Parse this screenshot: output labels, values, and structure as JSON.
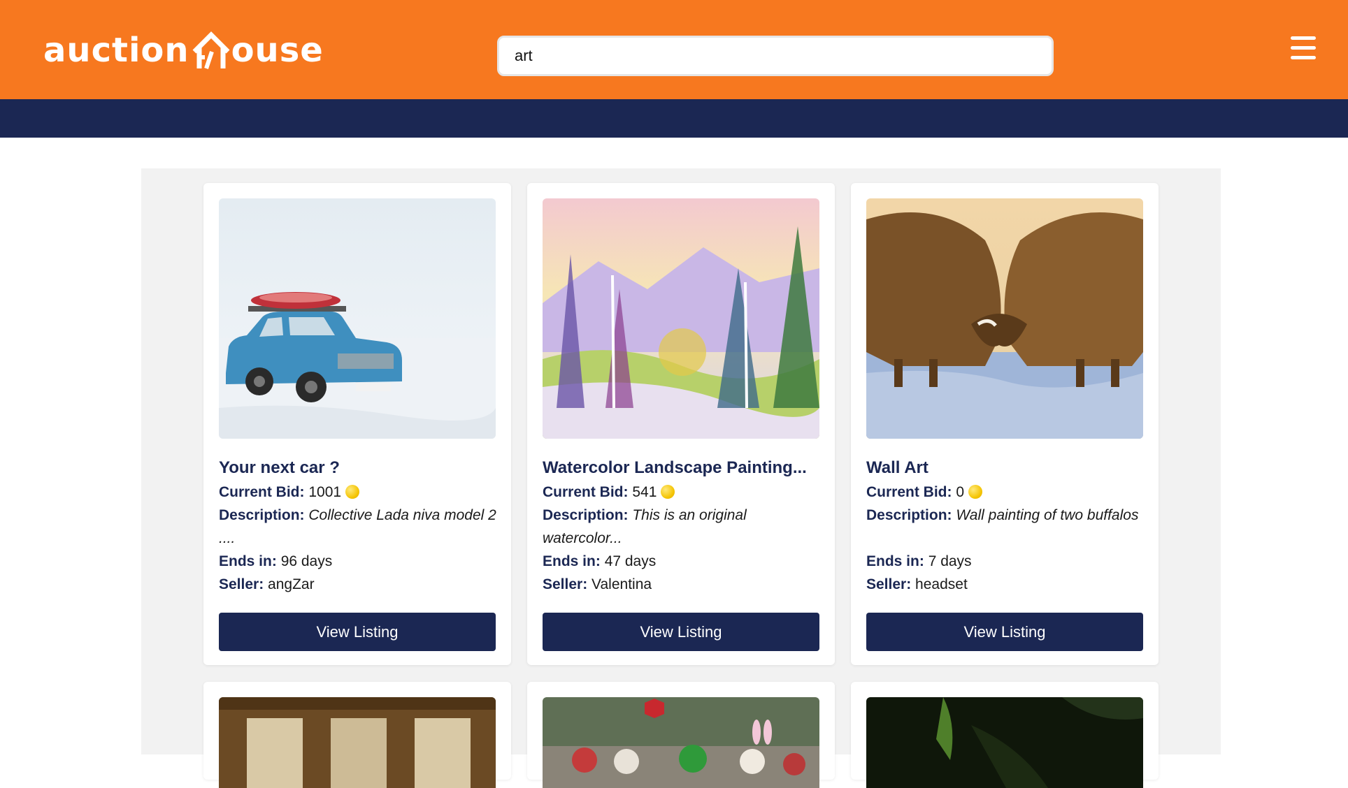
{
  "header": {
    "logo_left": "auction",
    "logo_right": "ouse",
    "search": {
      "value": "art",
      "placeholder": ""
    },
    "brand_color": "#f7781f",
    "nav_color": "#1b2753"
  },
  "listings": [
    {
      "title": "Your next car ?",
      "bid_label": "Current Bid:",
      "bid_value": "1001",
      "desc_label": "Description:",
      "desc_value": "Collective Lada niva model 2 ....",
      "ends_label": "Ends in:",
      "ends_value": "96 days",
      "seller_label": "Seller:",
      "seller_value": "angZar",
      "button_label": "View Listing",
      "image": "blue-car-in-snow"
    },
    {
      "title": "Watercolor Landscape Painting...",
      "bid_label": "Current Bid:",
      "bid_value": "541",
      "desc_label": "Description:",
      "desc_value": "This is an original watercolor...",
      "ends_label": "Ends in:",
      "ends_value": "47 days",
      "seller_label": "Seller:",
      "seller_value": "Valentina",
      "button_label": "View Listing",
      "image": "watercolor-landscape"
    },
    {
      "title": "Wall Art",
      "bid_label": "Current Bid:",
      "bid_value": "0",
      "desc_label": "Description:",
      "desc_value": "Wall painting of two buffalos",
      "ends_label": "Ends in:",
      "ends_value": "7 days",
      "seller_label": "Seller:",
      "seller_value": "headset",
      "button_label": "View Listing",
      "image": "two-buffalos"
    }
  ],
  "partial_listings": [
    {
      "image": "wooden-interior"
    },
    {
      "image": "street-crowd-stop-sign"
    },
    {
      "image": "dark-foliage"
    }
  ]
}
